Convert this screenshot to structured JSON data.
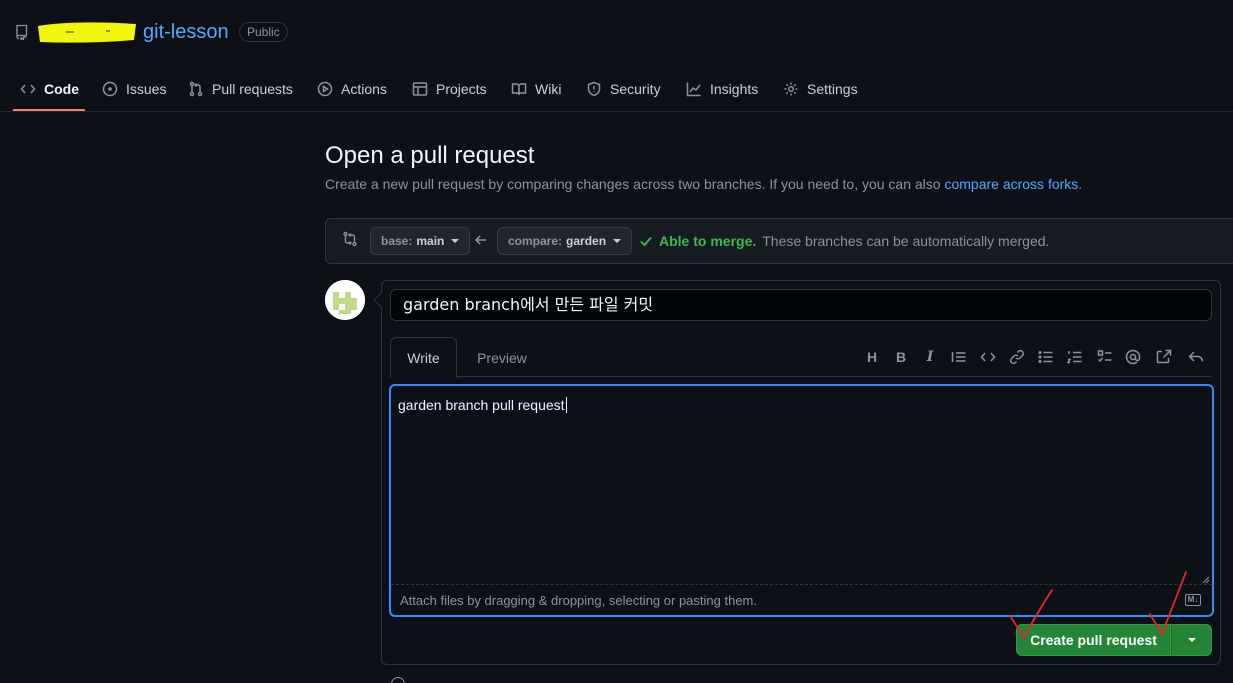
{
  "repo": {
    "name": "git-lesson",
    "visibility": "Public"
  },
  "nav": {
    "items": [
      {
        "label": "Code",
        "icon": "code-icon"
      },
      {
        "label": "Issues",
        "icon": "issue-icon"
      },
      {
        "label": "Pull requests",
        "icon": "pull-request-icon"
      },
      {
        "label": "Actions",
        "icon": "play-icon"
      },
      {
        "label": "Projects",
        "icon": "table-icon"
      },
      {
        "label": "Wiki",
        "icon": "book-icon"
      },
      {
        "label": "Security",
        "icon": "shield-icon"
      },
      {
        "label": "Insights",
        "icon": "graph-icon"
      },
      {
        "label": "Settings",
        "icon": "gear-icon"
      }
    ],
    "selected": "Code"
  },
  "page": {
    "title": "Open a pull request",
    "subtitle": "Create a new pull request by comparing changes across two branches. If you need to, you can also ",
    "subtitle_link": "compare across forks",
    "subtitle_end": "."
  },
  "compare": {
    "base_label": "base:",
    "base_value": "main",
    "compare_label": "compare:",
    "compare_value": "garden",
    "status_ok": "Able to merge.",
    "status_desc": "These branches can be automatically merged."
  },
  "form": {
    "title_value": "garden branch에서 만든 파일 커밋",
    "tabs": [
      "Write",
      "Preview"
    ],
    "selected_tab": "Write",
    "toolbar": [
      "H",
      "B",
      "I"
    ],
    "body_value": "garden branch pull request",
    "attach_hint": "Attach files by dragging & dropping, selecting or pasting them.",
    "markdown_badge": "M↓",
    "submit_label": "Create pull request"
  },
  "colors": {
    "accent": "#58a6ff",
    "success": "#238636",
    "nav_underline": "#f78166",
    "annotation": "#e5252a"
  }
}
